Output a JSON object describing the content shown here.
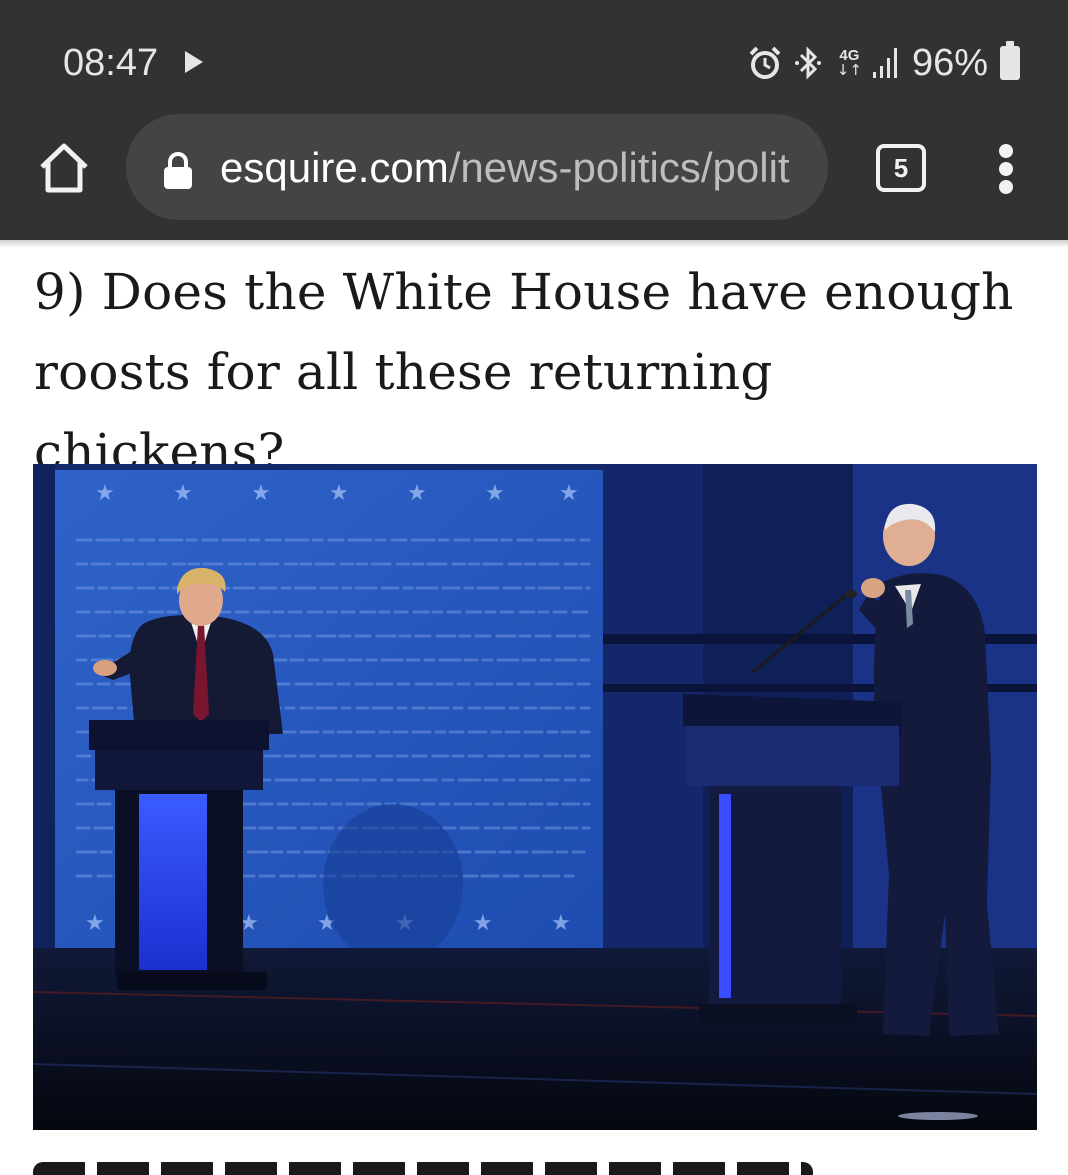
{
  "status_bar": {
    "time": "08:47",
    "network": "4G",
    "battery": "96%",
    "icons": [
      "play-icon",
      "alarm-icon",
      "bluetooth-icon",
      "network-4g-icon",
      "signal-icon",
      "battery-icon"
    ]
  },
  "browser": {
    "url_host": "esquire.com",
    "url_path": "/news-politics/polit",
    "tab_count": "5",
    "icons": [
      "home-icon",
      "lock-icon",
      "tabs-icon",
      "more-vert-icon"
    ]
  },
  "article": {
    "headline": "9) Does the White House have enough roosts for all these returning chickens?"
  },
  "colors": {
    "toolbar_bg": "#323232",
    "urlbar_bg": "#444444",
    "stage_blue": "#1f4fb5"
  }
}
